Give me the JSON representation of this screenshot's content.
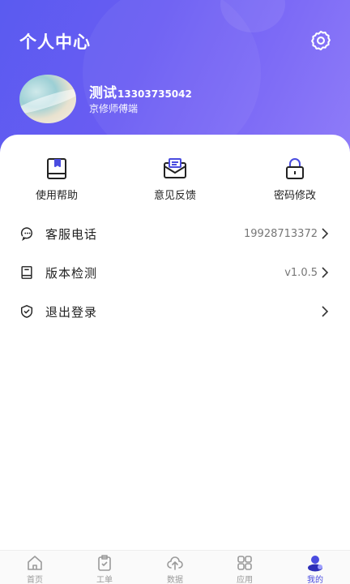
{
  "header": {
    "title": "个人中心",
    "settings_icon": "gear-icon"
  },
  "user": {
    "name": "测试",
    "phone": "13303735042",
    "shop": "京修师傅端"
  },
  "quick_actions": [
    {
      "label": "使用帮助",
      "icon": "book-icon"
    },
    {
      "label": "意见反馈",
      "icon": "mail-icon"
    },
    {
      "label": "密码修改",
      "icon": "lock-icon"
    }
  ],
  "menu": [
    {
      "label": "客服电话",
      "value": "19928713372",
      "icon": "phone-icon"
    },
    {
      "label": "版本检测",
      "value": "v1.0.5",
      "icon": "document-icon"
    },
    {
      "label": "退出登录",
      "value": "",
      "icon": "shield-icon"
    }
  ],
  "tabs": [
    {
      "label": "首页",
      "icon": "home-icon"
    },
    {
      "label": "工单",
      "icon": "clipboard-icon"
    },
    {
      "label": "数据",
      "icon": "cloud-icon"
    },
    {
      "label": "应用",
      "icon": "grid-icon"
    },
    {
      "label": "我的",
      "icon": "user-icon",
      "active": true
    }
  ],
  "colors": {
    "accent": "#4a4ce0",
    "header_start": "#5a5bf0",
    "header_end": "#8f7cf8"
  }
}
